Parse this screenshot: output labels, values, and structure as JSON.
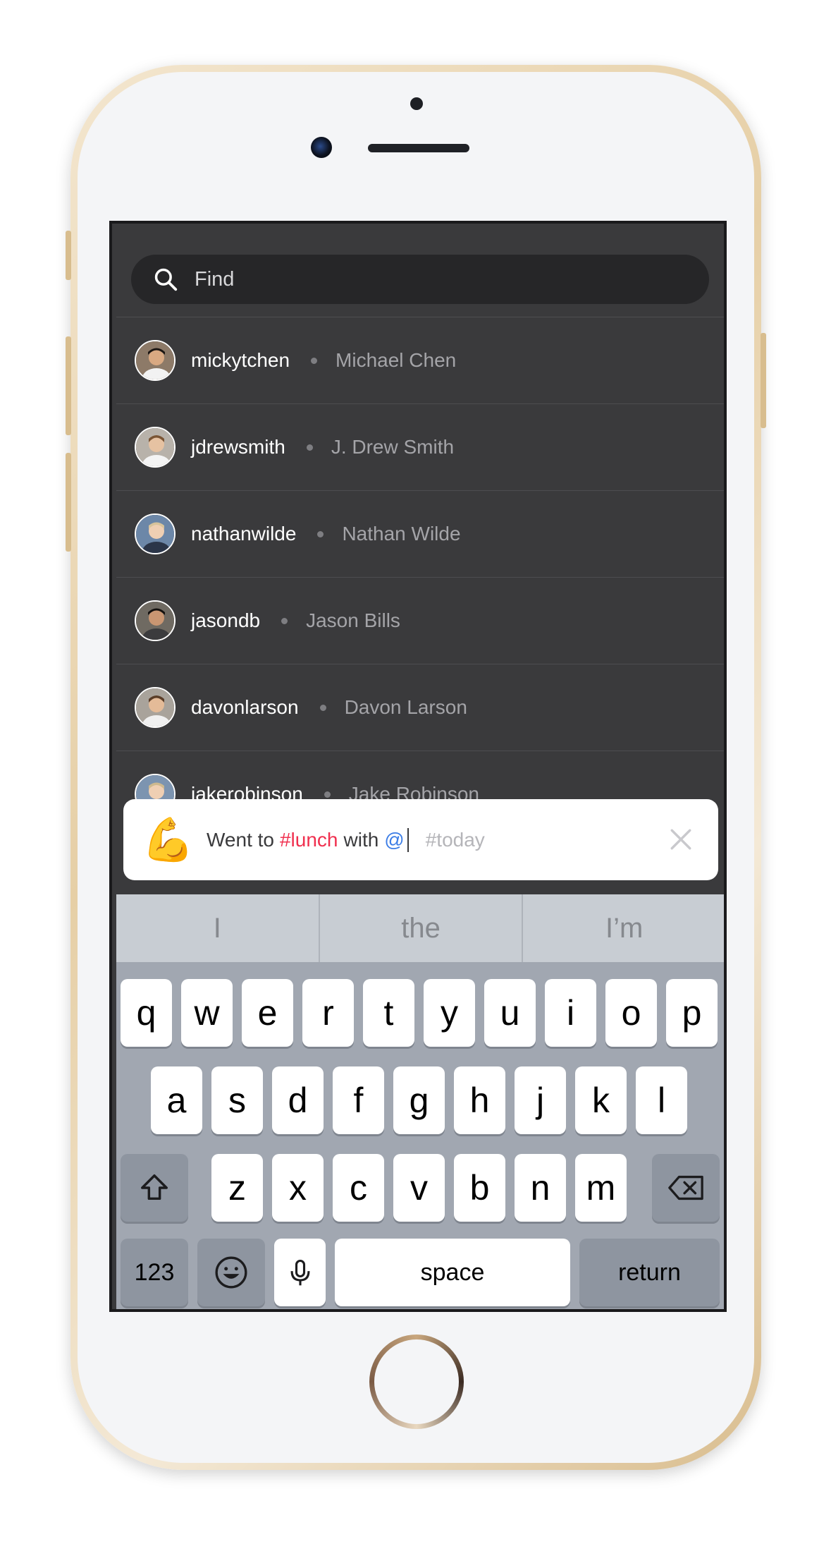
{
  "search": {
    "placeholder": "Find"
  },
  "users": [
    {
      "handle": "mickytchen",
      "name": "Michael Chen"
    },
    {
      "handle": "jdrewsmith",
      "name": "J. Drew Smith"
    },
    {
      "handle": "nathanwilde",
      "name": "Nathan Wilde"
    },
    {
      "handle": "jasondb",
      "name": "Jason Bills"
    },
    {
      "handle": "davonlarson",
      "name": "Davon Larson"
    },
    {
      "handle": "jakerobinson",
      "name": "Jake Robinson"
    }
  ],
  "compose": {
    "emoji": "💪",
    "prefix": "Went to",
    "hashtag": "#lunch",
    "middle": "with",
    "mention": "@",
    "hint": "#today"
  },
  "keyboard": {
    "predictions": [
      "I",
      "the",
      "I’m"
    ],
    "row1": [
      "q",
      "w",
      "e",
      "r",
      "t",
      "y",
      "u",
      "i",
      "o",
      "p"
    ],
    "row2": [
      "a",
      "s",
      "d",
      "f",
      "g",
      "h",
      "j",
      "k",
      "l"
    ],
    "row3": [
      "z",
      "x",
      "c",
      "v",
      "b",
      "n",
      "m"
    ],
    "numbers_label": "123",
    "space_label": "space",
    "return_label": "return"
  },
  "colors": {
    "hashtag": "#f0304f",
    "mention": "#3c7de6",
    "phone_gold": "#e6cfa6"
  }
}
